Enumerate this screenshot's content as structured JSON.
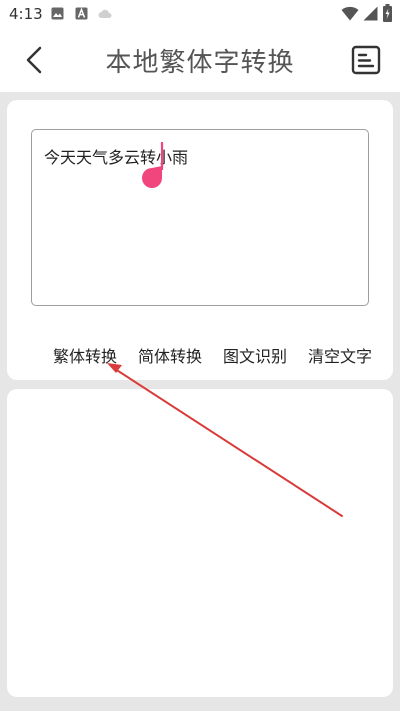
{
  "status_bar": {
    "time": "4:13",
    "icons": [
      "gallery-icon",
      "a-notification-icon",
      "cloud-icon",
      "wifi-icon",
      "signal-icon",
      "battery-icon"
    ]
  },
  "app_bar": {
    "title": "本地繁体字转换",
    "back_icon": "chevron-left-icon",
    "menu_icon": "document-list-icon"
  },
  "input": {
    "value": "今天天气多云转小雨"
  },
  "actions": {
    "traditional": "繁体转换",
    "simplified": "简体转换",
    "ocr": "图文识别",
    "clear": "清空文字"
  },
  "colors": {
    "cursor_handle": "#f0457d",
    "annotation_arrow": "#d93a3a",
    "title_text": "#555555"
  }
}
